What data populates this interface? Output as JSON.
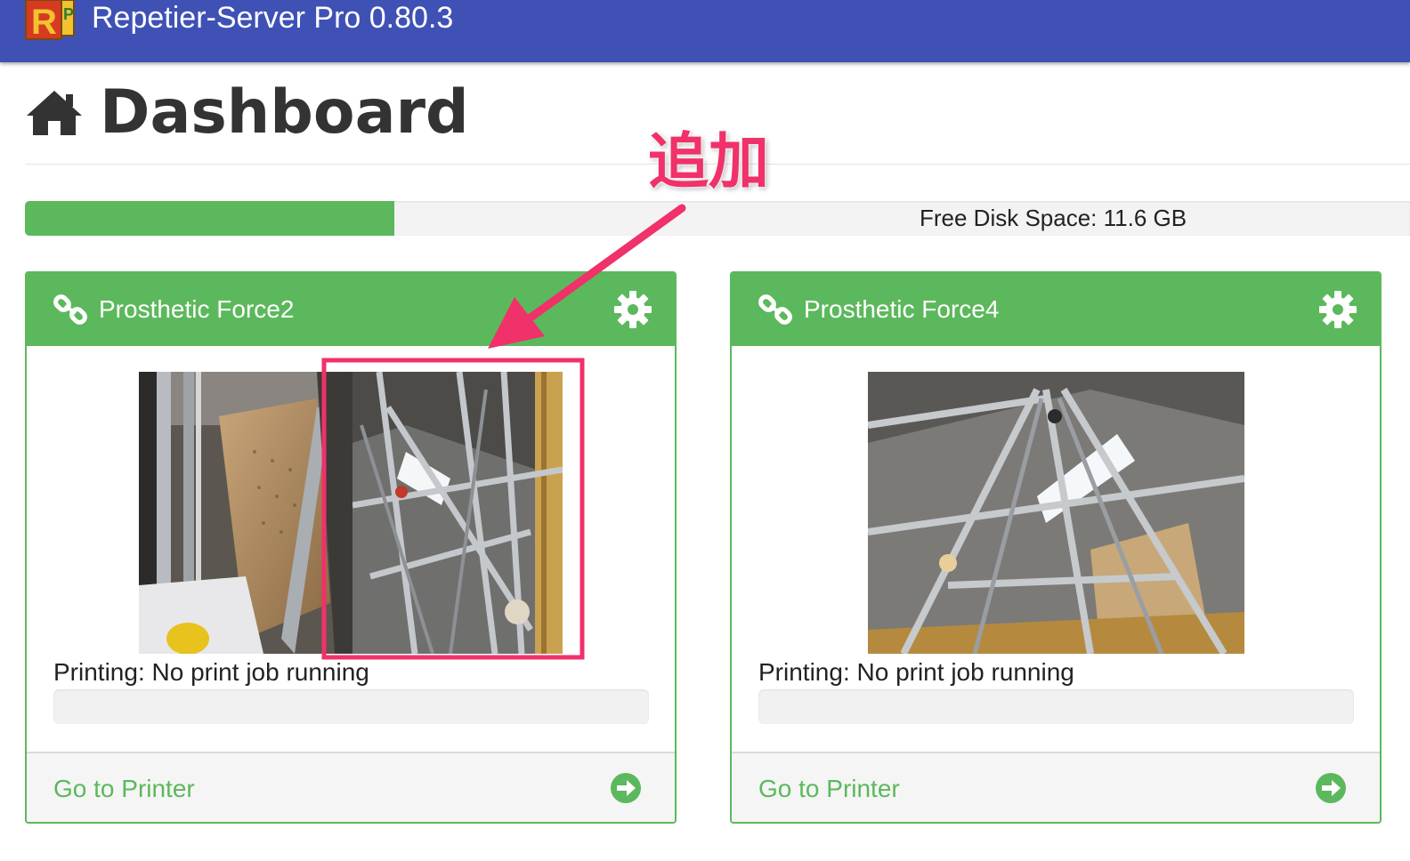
{
  "header": {
    "app_title": "Repetier-Server Pro 0.80.3",
    "logo_letters": "RP",
    "logo_icon": "abc-blocks-logo"
  },
  "page": {
    "title": "Dashboard",
    "icon": "home-icon"
  },
  "disk": {
    "label": "Free Disk Space: 11.6 GB",
    "used_fraction": 0.267
  },
  "annotation": {
    "text": "追加",
    "color": "#f0316a"
  },
  "printers": [
    {
      "name": "Prosthetic Force2",
      "status": "Printing: No print job running",
      "job_progress": 0,
      "link_label": "Go to Printer",
      "webcams": 2
    },
    {
      "name": "Prosthetic Force4",
      "status": "Printing: No print job running",
      "job_progress": 0,
      "link_label": "Go to Printer",
      "webcams": 1
    }
  ],
  "colors": {
    "topbar": "#3f51b5",
    "accent": "#5cb85c",
    "annotation": "#f0316a"
  }
}
